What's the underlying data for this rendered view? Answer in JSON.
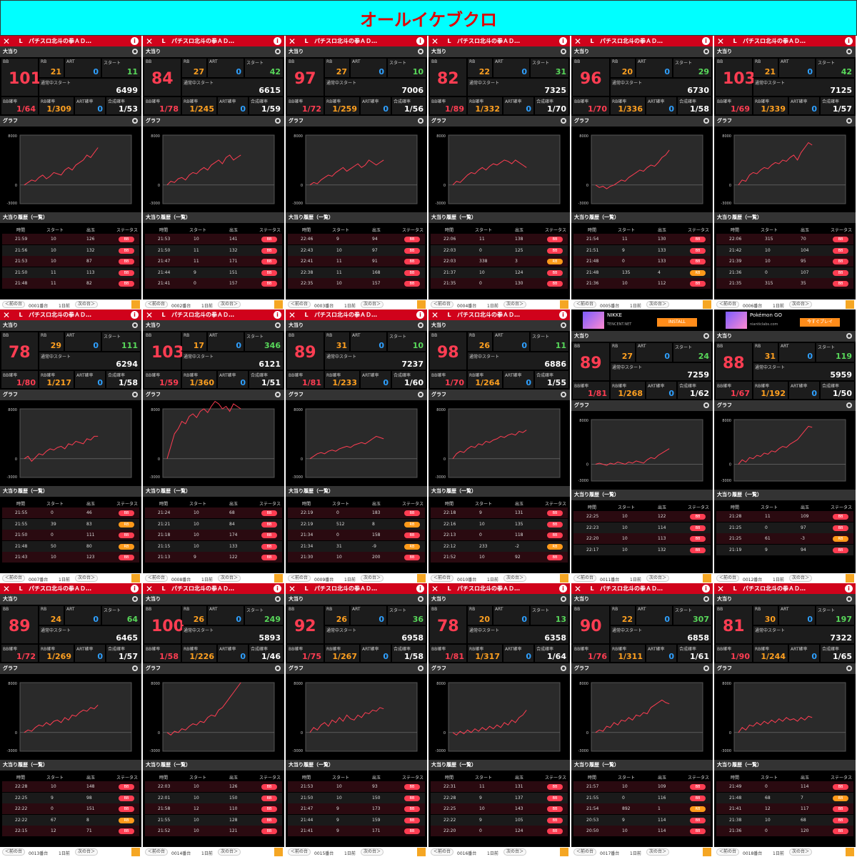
{
  "title": "オールイケブクロ",
  "labels": {
    "header_l": "L",
    "header_title": "パチスロ北斗の拳ＡＤ…",
    "big_hit": "大当り",
    "graph": "グラフ",
    "history": "大当り履歴（一覧）",
    "bb": "BB",
    "rb": "RB",
    "art": "ART",
    "start": "スタート",
    "normal_start": "通常中スタート",
    "bb_prob": "BB確率",
    "rb_prob": "RB確率",
    "art_prob": "ART確率",
    "combined_prob": "合成確率",
    "col_time": "時間",
    "col_start": "スタート",
    "col_out": "出玉",
    "col_status": "ステータス",
    "prev": "＜前の台",
    "day": "1日前",
    "next": "次の台＞",
    "axis_top": "8000",
    "axis_zero": "0",
    "axis_bottom": "-3000"
  },
  "machines": [
    {
      "no": "0001番台",
      "bb": "101",
      "rb": "21",
      "art": "0",
      "start": "11",
      "total": "6499",
      "bbp": "1/64",
      "rbp": "1/309",
      "artp": "0",
      "cp": "1/53",
      "hist": [
        [
          "21:59",
          "10",
          "126",
          "BB"
        ],
        [
          "21:56",
          "10",
          "132",
          "BB"
        ],
        [
          "21:53",
          "10",
          "87",
          "BB"
        ],
        [
          "21:50",
          "11",
          "113",
          "BB"
        ],
        [
          "21:48",
          "11",
          "82",
          "BB"
        ]
      ],
      "graph": [
        0,
        2,
        4,
        3,
        6,
        8,
        5,
        7,
        10,
        9,
        8,
        12,
        14,
        12,
        16,
        18,
        20,
        24,
        22,
        26,
        30
      ]
    },
    {
      "no": "0002番台",
      "bb": "84",
      "rb": "27",
      "art": "0",
      "start": "42",
      "total": "6615",
      "bbp": "1/78",
      "rbp": "1/245",
      "artp": "0",
      "cp": "1/59",
      "hist": [
        [
          "21:53",
          "10",
          "141",
          "BB"
        ],
        [
          "21:50",
          "11",
          "132",
          "BB"
        ],
        [
          "21:47",
          "11",
          "171",
          "BB"
        ],
        [
          "21:44",
          "9",
          "151",
          "BB"
        ],
        [
          "21:41",
          "0",
          "157",
          "BB"
        ]
      ],
      "graph": [
        0,
        3,
        2,
        5,
        6,
        4,
        8,
        10,
        9,
        12,
        14,
        12,
        16,
        18,
        20,
        17,
        22,
        24,
        20,
        22,
        24
      ]
    },
    {
      "no": "0003番台",
      "bb": "97",
      "rb": "27",
      "art": "0",
      "start": "10",
      "total": "7006",
      "bbp": "1/72",
      "rbp": "1/259",
      "artp": "0",
      "cp": "1/56",
      "hist": [
        [
          "22:46",
          "9",
          "94",
          "BB"
        ],
        [
          "22:43",
          "10",
          "97",
          "BB"
        ],
        [
          "22:41",
          "11",
          "91",
          "BB"
        ],
        [
          "22:38",
          "11",
          "168",
          "BB"
        ],
        [
          "22:35",
          "10",
          "157",
          "BB"
        ]
      ],
      "graph": [
        0,
        2,
        1,
        4,
        6,
        8,
        7,
        10,
        12,
        14,
        11,
        13,
        15,
        17,
        14,
        16,
        20,
        18,
        16,
        18,
        20
      ]
    },
    {
      "no": "0004番台",
      "bb": "82",
      "rb": "22",
      "art": "0",
      "start": "31",
      "total": "7325",
      "bbp": "1/89",
      "rbp": "1/332",
      "artp": "0",
      "cp": "1/70",
      "hist": [
        [
          "22:06",
          "11",
          "138",
          "BB"
        ],
        [
          "22:03",
          "0",
          "125",
          "BB"
        ],
        [
          "22:03",
          "338",
          "3",
          "RB"
        ],
        [
          "21:37",
          "10",
          "124",
          "BB"
        ],
        [
          "21:35",
          "0",
          "130",
          "BB"
        ]
      ],
      "graph": [
        0,
        3,
        2,
        5,
        8,
        10,
        9,
        12,
        14,
        12,
        15,
        17,
        16,
        18,
        20,
        19,
        17,
        20,
        18,
        16,
        14
      ]
    },
    {
      "no": "0005番台",
      "bb": "96",
      "rb": "20",
      "art": "0",
      "start": "29",
      "total": "6730",
      "bbp": "1/70",
      "rbp": "1/336",
      "artp": "0",
      "cp": "1/58",
      "hist": [
        [
          "21:54",
          "11",
          "130",
          "BB"
        ],
        [
          "21:51",
          "9",
          "133",
          "BB"
        ],
        [
          "21:48",
          "0",
          "133",
          "BB"
        ],
        [
          "21:48",
          "135",
          "4",
          "RB"
        ],
        [
          "21:36",
          "10",
          "112",
          "BB"
        ]
      ],
      "graph": [
        0,
        -2,
        -1,
        -3,
        -1,
        0,
        2,
        4,
        3,
        6,
        8,
        10,
        12,
        11,
        14,
        16,
        15,
        18,
        22,
        24,
        28
      ]
    },
    {
      "no": "0006番台",
      "bb": "103",
      "rb": "21",
      "art": "0",
      "start": "42",
      "total": "7125",
      "bbp": "1/69",
      "rbp": "1/339",
      "artp": "0",
      "cp": "1/57",
      "hist": [
        [
          "22:06",
          "315",
          "70",
          "BB"
        ],
        [
          "21:42",
          "10",
          "104",
          "BB"
        ],
        [
          "21:39",
          "10",
          "95",
          "BB"
        ],
        [
          "21:36",
          "0",
          "107",
          "BB"
        ],
        [
          "21:35",
          "315",
          "35",
          "BB"
        ]
      ],
      "graph": [
        0,
        4,
        3,
        8,
        10,
        9,
        12,
        14,
        13,
        16,
        18,
        17,
        20,
        19,
        22,
        24,
        20,
        26,
        30,
        34,
        32
      ]
    },
    {
      "no": "0007番台",
      "bb": "78",
      "rb": "29",
      "art": "0",
      "start": "111",
      "total": "6294",
      "bbp": "1/80",
      "rbp": "1/217",
      "artp": "0",
      "cp": "1/58",
      "hist": [
        [
          "21:55",
          "0",
          "46",
          "BB"
        ],
        [
          "21:55",
          "39",
          "83",
          "RB"
        ],
        [
          "21:50",
          "0",
          "111",
          "BB"
        ],
        [
          "21:48",
          "50",
          "80",
          "RB"
        ],
        [
          "21:43",
          "10",
          "123",
          "BB"
        ]
      ],
      "graph": [
        0,
        2,
        -2,
        1,
        4,
        3,
        6,
        8,
        7,
        9,
        10,
        8,
        12,
        11,
        14,
        13,
        12,
        16,
        15,
        18,
        18
      ]
    },
    {
      "no": "0008番台",
      "bb": "103",
      "rb": "17",
      "art": "0",
      "start": "346",
      "total": "6121",
      "bbp": "1/59",
      "rbp": "1/360",
      "artp": "0",
      "cp": "1/51",
      "hist": [
        [
          "21:24",
          "10",
          "68",
          "BB"
        ],
        [
          "21:21",
          "10",
          "84",
          "BB"
        ],
        [
          "21:18",
          "10",
          "174",
          "BB"
        ],
        [
          "21:15",
          "10",
          "133",
          "BB"
        ],
        [
          "21:13",
          "9",
          "122",
          "BB"
        ]
      ],
      "graph": [
        0,
        10,
        20,
        24,
        30,
        28,
        34,
        36,
        33,
        38,
        40,
        37,
        42,
        46,
        44,
        40,
        42,
        38,
        44,
        42,
        40
      ]
    },
    {
      "no": "0009番台",
      "bb": "89",
      "rb": "31",
      "art": "0",
      "start": "10",
      "total": "7237",
      "bbp": "1/81",
      "rbp": "1/233",
      "artp": "0",
      "cp": "1/60",
      "hist": [
        [
          "22:19",
          "0",
          "183",
          "BB"
        ],
        [
          "22:19",
          "512",
          "8",
          "RB"
        ],
        [
          "21:34",
          "0",
          "158",
          "BB"
        ],
        [
          "21:34",
          "31",
          "-9",
          "RB"
        ],
        [
          "21:30",
          "10",
          "200",
          "BB"
        ]
      ],
      "graph": [
        0,
        2,
        4,
        5,
        4,
        6,
        7,
        6,
        8,
        9,
        10,
        9,
        11,
        12,
        13,
        12,
        14,
        16,
        18,
        17,
        16
      ]
    },
    {
      "no": "0010番台",
      "bb": "98",
      "rb": "26",
      "art": "0",
      "start": "11",
      "total": "6886",
      "bbp": "1/70",
      "rbp": "1/264",
      "artp": "0",
      "cp": "1/55",
      "hist": [
        [
          "22:18",
          "9",
          "131",
          "BB"
        ],
        [
          "22:16",
          "10",
          "135",
          "BB"
        ],
        [
          "22:13",
          "0",
          "118",
          "BB"
        ],
        [
          "22:12",
          "233",
          "-2",
          "RB"
        ],
        [
          "21:52",
          "10",
          "92",
          "BB"
        ]
      ],
      "graph": [
        0,
        4,
        6,
        5,
        8,
        10,
        9,
        12,
        11,
        14,
        13,
        15,
        16,
        18,
        17,
        19,
        20,
        19,
        22,
        21,
        23
      ]
    },
    {
      "no": "0011番台",
      "bb": "89",
      "rb": "27",
      "art": "0",
      "start": "24",
      "total": "7259",
      "bbp": "1/81",
      "rbp": "1/268",
      "artp": "0",
      "cp": "1/62",
      "hist": [
        [
          "22:25",
          "10",
          "122",
          "BB"
        ],
        [
          "22:23",
          "10",
          "114",
          "BB"
        ],
        [
          "22:20",
          "10",
          "113",
          "BB"
        ],
        [
          "22:17",
          "10",
          "132",
          "BB"
        ]
      ],
      "graph": [
        0,
        1,
        0,
        -1,
        1,
        0,
        2,
        1,
        0,
        2,
        1,
        3,
        2,
        1,
        4,
        6,
        5,
        8,
        10,
        12,
        14
      ]
    },
    {
      "no": "0012番台",
      "bb": "88",
      "rb": "31",
      "art": "0",
      "start": "119",
      "total": "5959",
      "bbp": "1/67",
      "rbp": "1/192",
      "artp": "0",
      "cp": "1/50",
      "hist": [
        [
          "21:28",
          "11",
          "109",
          "BB"
        ],
        [
          "21:25",
          "0",
          "97",
          "BB"
        ],
        [
          "21:25",
          "61",
          "-3",
          "RB"
        ],
        [
          "21:19",
          "9",
          "94",
          "BB"
        ]
      ],
      "graph": [
        0,
        4,
        2,
        6,
        5,
        8,
        7,
        10,
        9,
        12,
        11,
        14,
        16,
        15,
        18,
        20,
        22,
        26,
        30,
        34,
        33
      ]
    },
    {
      "no": "0013番台",
      "bb": "89",
      "rb": "24",
      "art": "0",
      "start": "64",
      "total": "6465",
      "bbp": "1/72",
      "rbp": "1/269",
      "artp": "0",
      "cp": "1/57",
      "hist": [
        [
          "22:28",
          "10",
          "148",
          "BB"
        ],
        [
          "22:25",
          "9",
          "98",
          "BB"
        ],
        [
          "22:22",
          "0",
          "151",
          "BB"
        ],
        [
          "22:22",
          "67",
          "8",
          "RB"
        ],
        [
          "22:15",
          "12",
          "71",
          "BB"
        ]
      ],
      "graph": [
        0,
        2,
        1,
        4,
        6,
        5,
        8,
        6,
        9,
        10,
        8,
        12,
        10,
        14,
        13,
        16,
        18,
        17,
        20,
        19,
        22
      ]
    },
    {
      "no": "0014番台",
      "bb": "100",
      "rb": "26",
      "art": "0",
      "start": "249",
      "total": "5893",
      "bbp": "1/58",
      "rbp": "1/226",
      "artp": "0",
      "cp": "1/46",
      "hist": [
        [
          "22:03",
          "10",
          "126",
          "BB"
        ],
        [
          "22:01",
          "10",
          "150",
          "BB"
        ],
        [
          "21:58",
          "12",
          "110",
          "BB"
        ],
        [
          "21:55",
          "10",
          "128",
          "BB"
        ],
        [
          "21:52",
          "10",
          "121",
          "BB"
        ]
      ],
      "graph": [
        0,
        -2,
        1,
        0,
        3,
        2,
        5,
        7,
        6,
        9,
        8,
        12,
        14,
        13,
        18,
        20,
        24,
        28,
        32,
        36,
        40
      ]
    },
    {
      "no": "0015番台",
      "bb": "92",
      "rb": "26",
      "art": "0",
      "start": "36",
      "total": "6958",
      "bbp": "1/75",
      "rbp": "1/267",
      "artp": "0",
      "cp": "1/58",
      "hist": [
        [
          "21:53",
          "10",
          "93",
          "BB"
        ],
        [
          "21:50",
          "10",
          "150",
          "BB"
        ],
        [
          "21:47",
          "9",
          "173",
          "BB"
        ],
        [
          "21:44",
          "9",
          "159",
          "BB"
        ],
        [
          "21:41",
          "9",
          "171",
          "BB"
        ]
      ],
      "graph": [
        0,
        4,
        2,
        6,
        8,
        5,
        10,
        8,
        12,
        9,
        14,
        11,
        10,
        14,
        12,
        16,
        15,
        18,
        17,
        20,
        19
      ]
    },
    {
      "no": "0016番台",
      "bb": "78",
      "rb": "20",
      "art": "0",
      "start": "13",
      "total": "6358",
      "bbp": "1/81",
      "rbp": "1/317",
      "artp": "0",
      "cp": "1/64",
      "hist": [
        [
          "22:31",
          "11",
          "131",
          "BB"
        ],
        [
          "22:28",
          "9",
          "137",
          "BB"
        ],
        [
          "22:25",
          "10",
          "143",
          "BB"
        ],
        [
          "22:22",
          "9",
          "105",
          "BB"
        ],
        [
          "22:20",
          "0",
          "124",
          "BB"
        ]
      ],
      "graph": [
        0,
        -2,
        1,
        -1,
        2,
        0,
        3,
        1,
        4,
        2,
        5,
        3,
        6,
        4,
        8,
        6,
        10,
        8,
        12,
        14,
        18
      ]
    },
    {
      "no": "0017番台",
      "bb": "90",
      "rb": "22",
      "art": "0",
      "start": "307",
      "total": "6858",
      "bbp": "1/76",
      "rbp": "1/311",
      "artp": "0",
      "cp": "1/61",
      "hist": [
        [
          "21:57",
          "10",
          "109",
          "BB"
        ],
        [
          "21:55",
          "0",
          "116",
          "BB"
        ],
        [
          "21:54",
          "892",
          "1",
          "RB"
        ],
        [
          "20:53",
          "9",
          "114",
          "BB"
        ],
        [
          "20:50",
          "10",
          "114",
          "BB"
        ]
      ],
      "graph": [
        0,
        2,
        1,
        5,
        4,
        8,
        6,
        10,
        9,
        12,
        10,
        14,
        13,
        16,
        15,
        20,
        22,
        24,
        26,
        24,
        23
      ]
    },
    {
      "no": "0018番台",
      "bb": "81",
      "rb": "30",
      "art": "0",
      "start": "197",
      "total": "7322",
      "bbp": "1/90",
      "rbp": "1/244",
      "artp": "0",
      "cp": "1/65",
      "hist": [
        [
          "21:49",
          "0",
          "114",
          "BB"
        ],
        [
          "21:48",
          "68",
          "7",
          "RB"
        ],
        [
          "21:41",
          "12",
          "117",
          "BB"
        ],
        [
          "21:38",
          "10",
          "68",
          "BB"
        ],
        [
          "21:36",
          "0",
          "120",
          "BB"
        ]
      ],
      "graph": [
        0,
        4,
        2,
        6,
        5,
        8,
        6,
        9,
        7,
        10,
        8,
        11,
        9,
        12,
        10,
        11,
        9,
        12,
        10,
        13,
        12
      ]
    }
  ],
  "ads": [
    {
      "name": "NIKKE",
      "sub": "TENCENT.NET",
      "cta": "INSTALL"
    },
    {
      "name": "Pokémon GO",
      "sub": "nianticlabs.com",
      "cta": "今すぐプレイ"
    }
  ]
}
